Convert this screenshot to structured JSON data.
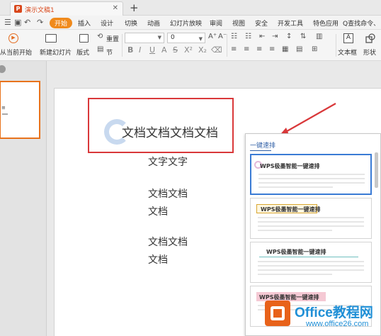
{
  "titlebar": {
    "doc_title": "演示文稿1",
    "new_tab": "+"
  },
  "menubar": {
    "items": [
      {
        "label": "开始",
        "active": true
      },
      {
        "label": "插入"
      },
      {
        "label": "设计"
      },
      {
        "label": "切换"
      },
      {
        "label": "动画"
      },
      {
        "label": "幻灯片放映"
      },
      {
        "label": "审阅"
      },
      {
        "label": "视图"
      },
      {
        "label": "安全"
      },
      {
        "label": "开发工具"
      },
      {
        "label": "特色应用"
      }
    ],
    "search": "Q查找命令、"
  },
  "ribbon": {
    "from_current": "从当前开始",
    "new_slide": "新建幻灯片",
    "layout": "版式",
    "reset": "重置",
    "section": "节",
    "font_size": "0",
    "textbox": "文本框",
    "shape": "形状"
  },
  "slide": {
    "title": "文档文档文档文档",
    "body": [
      "文字文字",
      "文档文档",
      "文档",
      "文档文档",
      "文档"
    ]
  },
  "panel": {
    "title": "一键速排",
    "templates": [
      "WPS极墨智能一键速排",
      "WPS极墨智能一键速排",
      "WPS极墨智能一键速排",
      "WPS极墨智能一键速排"
    ]
  },
  "watermark": {
    "brand": "Office教程网",
    "url": "www.office26.com"
  },
  "colors": {
    "accent_orange": "#f08a1c",
    "highlight_red": "#d9383a",
    "selection_blue": "#3a7bd5",
    "watermark_blue": "#1f8fd6"
  }
}
